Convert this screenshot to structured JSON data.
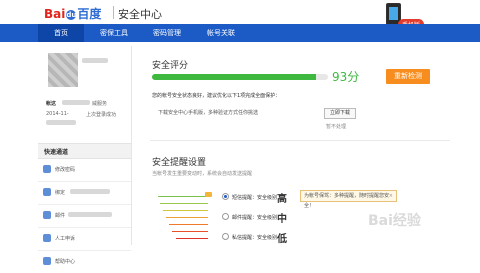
{
  "header": {
    "logo_text_red": "Bai",
    "logo_paw": "du",
    "logo_text_blue": "百度",
    "title": "安全中心",
    "phone_tag": "手机版"
  },
  "nav": {
    "items": [
      "首页",
      "密保工具",
      "密码管理",
      "帐号关联"
    ],
    "active_index": 0
  },
  "sidebar": {
    "account_label": "帐这",
    "account_suffix": "威服务",
    "login_time": "2014-11-",
    "last_login": "上次登录成功",
    "quick_title": "快速通道",
    "rows": [
      "修改密码",
      "绑定",
      "邮件",
      "人工申诉",
      "帮助中心"
    ]
  },
  "main": {
    "score_title": "安全评分",
    "score_value": 93,
    "score_text": "93分",
    "score_max": 100,
    "recheck_button": "重新检测",
    "status_text": "您的帐号安全状态良好，建议优化以下1项完成全面保护：",
    "download_text": "下载安全中心手机版，多种验证方式任你挑选",
    "download_button": "立即下载",
    "hide_link": "暂不处理",
    "settings_title": "安全提醒设置",
    "settings_subtitle": "当帐号发生重要变动时，系统会自动发送提醒",
    "levels": [
      {
        "label": "短信提醒：安全级别",
        "grade": "高",
        "checked": true
      },
      {
        "label": "邮件提醒：安全级别",
        "grade": "中",
        "checked": false
      },
      {
        "label": "私信提醒：安全级别",
        "grade": "低",
        "checked": false
      }
    ],
    "tip_text": "为帐号保驾：多种提醒，随时提醒您安全！",
    "tip_close": "×"
  },
  "watermark": "Bai经验",
  "colors": {
    "nav_bg": "#1c5bc6",
    "score_green": "#3fb83f",
    "orange_button": "#f78d1e",
    "brand_red": "#e1251b"
  }
}
